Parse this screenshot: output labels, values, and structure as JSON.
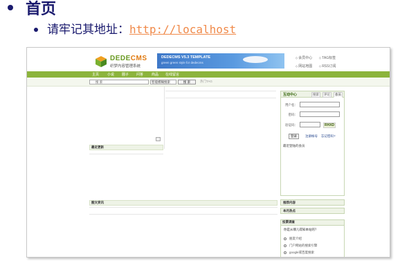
{
  "slide": {
    "heading": "首页",
    "subitem_prefix": "请牢记其地址：",
    "subitem_url": "http://localhost"
  },
  "screenshot": {
    "logo": {
      "name_a": "DEDE",
      "name_b": "CMS",
      "subtitle": "织梦内容管理系统"
    },
    "banner": {
      "title": "DEDECMS V5.3 TEMPLATE",
      "subtitle": "green green style for dedecms"
    },
    "top_links": [
      "会员中心",
      "TAG标签",
      "网站地图",
      "RSS订阅"
    ],
    "nav": [
      "主页",
      "小说",
      "圈子",
      "问答",
      "商品",
      "在线留言"
    ],
    "search": {
      "placeholder": "搜 索",
      "select_value": "智能模糊搜索",
      "button": "搜 索",
      "hot_tags": "热门TAG"
    },
    "latest_update": "最近更新",
    "image_news": "图文资讯",
    "login_panel": {
      "title": "互动中心",
      "tabs": [
        "搜索",
        "评论",
        "会员"
      ],
      "username_label": "用户名：",
      "password_label": "密码：",
      "captcha_label": "验证码：",
      "captcha_value": "RHXD",
      "login_button": "登录",
      "register_link": "注册帐号",
      "forgot_link": "忘记密码?",
      "recent_members": "最近登陆的会员"
    },
    "recommended": "推荐内容",
    "monthly_hot": "本月热点",
    "survey": {
      "title": "投票调查",
      "question": "你是从哪儿得知本站的？",
      "options": [
        "朋友介绍",
        "门户网站的搜索引擎",
        "google或百度搜索"
      ]
    }
  }
}
